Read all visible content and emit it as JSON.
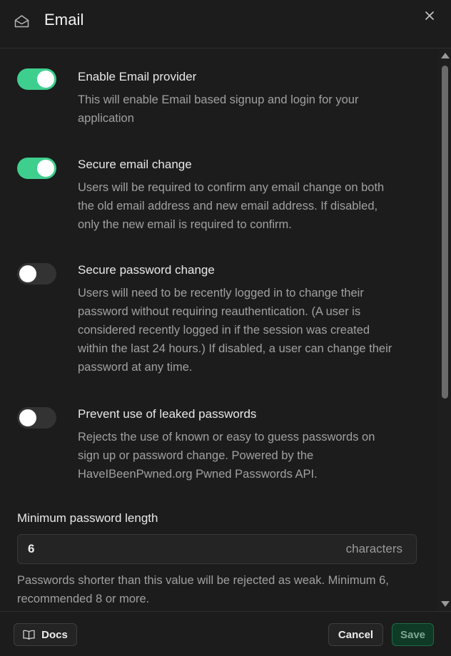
{
  "header": {
    "title": "Email"
  },
  "settings": [
    {
      "label": "Enable Email provider",
      "enabled": true,
      "description_lines": [
        "This will enable Email based signup and login for your",
        "application"
      ]
    },
    {
      "label": "Secure email change",
      "enabled": true,
      "description_lines": [
        "Users will be required to confirm any email change on both",
        "the old email address and new email address. If disabled,",
        "only the new email is required to confirm."
      ]
    },
    {
      "label": "Secure password change",
      "enabled": false,
      "description_lines": [
        "Users will need to be recently logged in to change their",
        "password without requiring reauthentication. (A user is",
        "considered recently logged in if the session was created",
        "within the last 24 hours.) If disabled, a user can change their",
        "password at any time."
      ]
    },
    {
      "label": "Prevent use of leaked passwords",
      "enabled": false,
      "description_lines": [
        "Rejects the use of known or easy to guess passwords on",
        "sign up or password change. Powered by the",
        "HaveIBeenPwned.org Pwned Passwords API."
      ]
    }
  ],
  "min_password_length": {
    "label": "Minimum password length",
    "value": "6",
    "suffix": "characters",
    "help_lines": [
      "Passwords shorter than this value will be rejected as weak. Minimum 6,",
      "recommended 8 or more."
    ]
  },
  "footer": {
    "docs_label": "Docs",
    "cancel_label": "Cancel",
    "save_label": "Save"
  },
  "colors": {
    "accent": "#3ecf8e",
    "background": "#1c1c1c"
  }
}
